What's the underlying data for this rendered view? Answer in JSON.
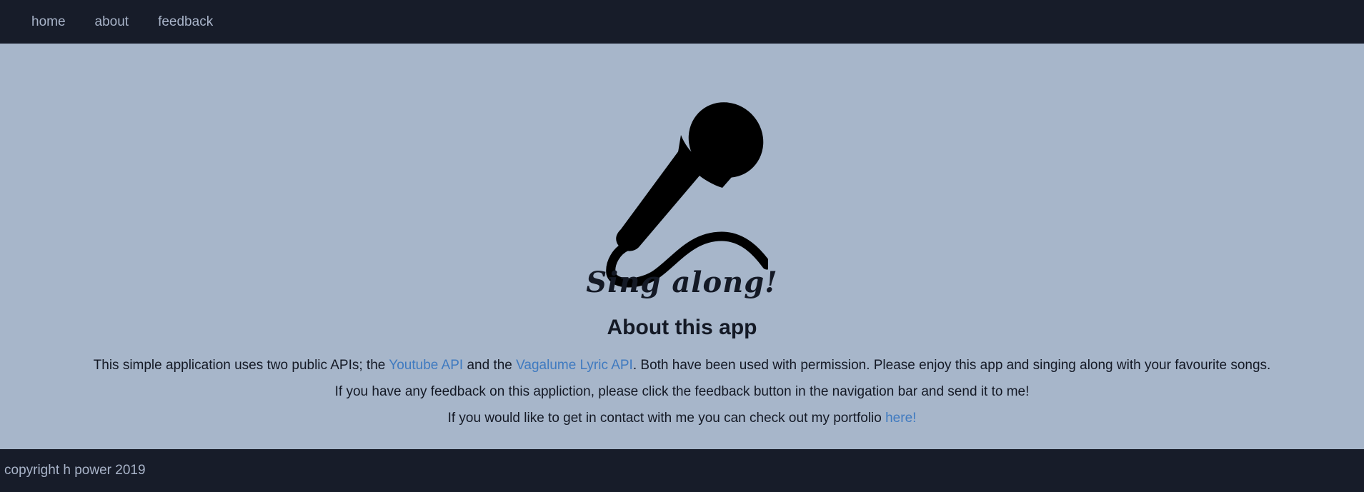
{
  "nav": {
    "items": [
      {
        "label": "home"
      },
      {
        "label": "about"
      },
      {
        "label": "feedback"
      }
    ]
  },
  "hero": {
    "icon": "microphone-icon",
    "title": "Sing along!",
    "subtitle": "About this app"
  },
  "content": {
    "p1": {
      "pre": "This simple application uses two public APIs; the ",
      "link1": "Youtube API",
      "mid": " and the ",
      "link2": "Vagalume Lyric API",
      "post": ". Both have been used with permission. Please enjoy this app and singing along with your favourite songs."
    },
    "p2": "If you have any feedback on this appliction, please click the feedback button in the navigation bar and send it to me!",
    "p3": {
      "pre": "If you would like to get in contact with me you can check out my portfolio ",
      "link": "here!"
    }
  },
  "footer": {
    "copyright": "copyright h power 2019"
  },
  "colors": {
    "nav_bg": "#171c29",
    "main_bg": "#a7b6ca",
    "nav_text": "#a9b4c9",
    "text": "#141925",
    "link": "#3f7ac0"
  }
}
